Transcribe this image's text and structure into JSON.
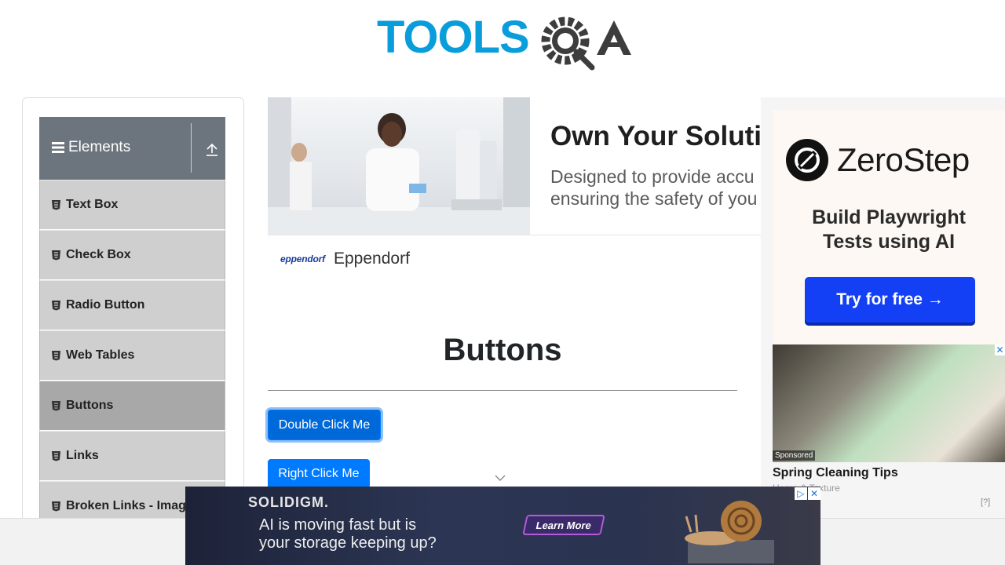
{
  "header": {
    "logo_text": "TOOLSQA"
  },
  "sidebar": {
    "group_title": "Elements",
    "items": [
      {
        "label": "Text Box"
      },
      {
        "label": "Check Box"
      },
      {
        "label": "Radio Button"
      },
      {
        "label": "Web Tables"
      },
      {
        "label": "Buttons",
        "active": true
      },
      {
        "label": "Links"
      },
      {
        "label": "Broken Links - Images"
      }
    ]
  },
  "content_ad": {
    "headline": "Own Your Solution",
    "body_line1": "Designed to provide accu",
    "body_line2": "ensuring the safety of you",
    "brand_logo": "eppendorf",
    "brand_name": "Eppendorf"
  },
  "main": {
    "title": "Buttons",
    "double_click_label": "Double Click Me",
    "right_click_label": "Right Click Me"
  },
  "right_ad": {
    "brand": "ZeroStep",
    "tagline_line1": "Build Playwright",
    "tagline_line2": "Tests using AI",
    "cta": "Try for free →",
    "sponsored_badge": "Sponsored",
    "sponsored_title": "Spring Cleaning Tips",
    "sponsored_source": "Home & Texture",
    "ad_label": "[?]"
  },
  "bottom_ad": {
    "brand": "SOLIDIGM.",
    "text_line1": "AI is moving fast but is",
    "text_line2": "your storage keeping up?",
    "cta": "Learn More"
  },
  "colors": {
    "primary_button": "#007bff",
    "sidebar_header": "#6c757d",
    "logo_blue": "#0a9ddb",
    "logo_dark": "#3d3d3d",
    "cta_blue": "#1340f5"
  }
}
